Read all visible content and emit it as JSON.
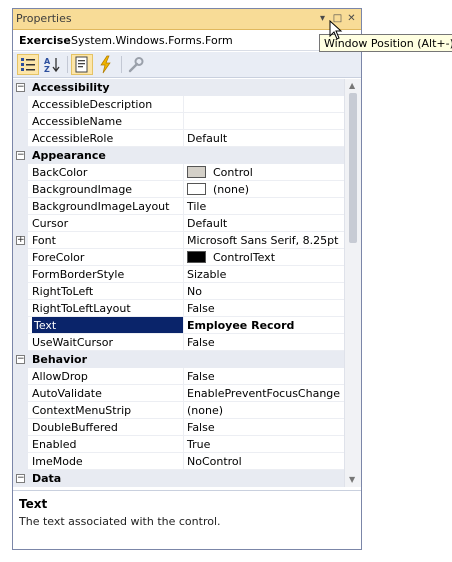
{
  "window": {
    "title": "Properties",
    "buttons": {
      "dropdown": "▾",
      "restore": "□",
      "close": "✕"
    }
  },
  "object": {
    "name": "Exercise",
    "type": "System.Windows.Forms.Form"
  },
  "tooltip": "Window Position (Alt+-)",
  "categories": [
    {
      "label": "Accessibility",
      "expander": "−",
      "properties": [
        {
          "name": "AccessibleDescription",
          "value": ""
        },
        {
          "name": "AccessibleName",
          "value": ""
        },
        {
          "name": "AccessibleRole",
          "value": "Default"
        }
      ]
    },
    {
      "label": "Appearance",
      "expander": "−",
      "properties": [
        {
          "name": "BackColor",
          "value": "Control",
          "swatch": "#d4d0c8"
        },
        {
          "name": "BackgroundImage",
          "value": "(none)",
          "swatch": "#ffffff"
        },
        {
          "name": "BackgroundImageLayout",
          "value": "Tile"
        },
        {
          "name": "Cursor",
          "value": "Default"
        },
        {
          "name": "Font",
          "value": "Microsoft Sans Serif, 8.25pt",
          "expander": "+"
        },
        {
          "name": "ForeColor",
          "value": "ControlText",
          "swatch": "#000000"
        },
        {
          "name": "FormBorderStyle",
          "value": "Sizable"
        },
        {
          "name": "RightToLeft",
          "value": "No"
        },
        {
          "name": "RightToLeftLayout",
          "value": "False"
        },
        {
          "name": "Text",
          "value": "Employee Record",
          "selected": true
        },
        {
          "name": "UseWaitCursor",
          "value": "False"
        }
      ]
    },
    {
      "label": "Behavior",
      "expander": "−",
      "properties": [
        {
          "name": "AllowDrop",
          "value": "False"
        },
        {
          "name": "AutoValidate",
          "value": "EnablePreventFocusChange"
        },
        {
          "name": "ContextMenuStrip",
          "value": "(none)"
        },
        {
          "name": "DoubleBuffered",
          "value": "False"
        },
        {
          "name": "Enabled",
          "value": "True"
        },
        {
          "name": "ImeMode",
          "value": "NoControl"
        }
      ]
    },
    {
      "label": "Data",
      "expander": "−",
      "properties": []
    }
  ],
  "description": {
    "title": "Text",
    "text": "The text associated with the control."
  },
  "colors": {
    "titlebar": "#f8dc97",
    "selection": "#0a246a",
    "category_bg": "#e8ebf2"
  }
}
